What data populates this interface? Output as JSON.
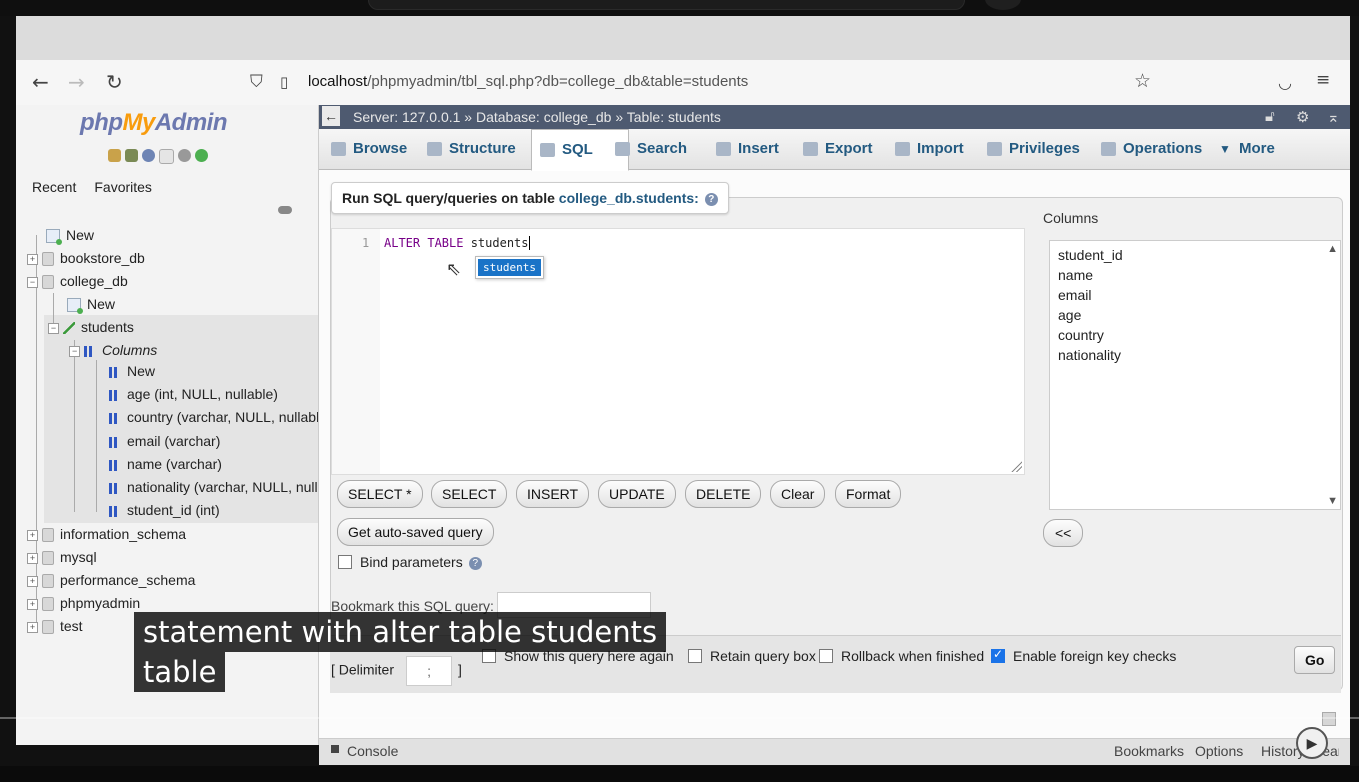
{
  "browser": {
    "url_host": "localhost",
    "url_path": "/phpmyadmin/tbl_sql.php?db=college_db&table=students"
  },
  "sidebar": {
    "logo_php": "php",
    "logo_my": "My",
    "logo_admin": "Admin",
    "tabs": [
      "Recent",
      "Favorites"
    ],
    "tree": {
      "new_root": "New",
      "bookstore": "bookstore_db",
      "college": "college_db",
      "college_new": "New",
      "students": "students",
      "columns": "Columns",
      "col_new": "New",
      "columns_list": [
        "age (int, NULL, nullable)",
        "country (varchar, NULL, nullable)",
        "email (varchar)",
        "name (varchar)",
        "nationality (varchar, NULL, nullable)",
        "student_id (int)"
      ],
      "info": "information_schema",
      "mysql": "mysql",
      "perf": "performance_schema",
      "pma": "phpmyadmin",
      "test": "test"
    }
  },
  "breadcrumb": {
    "server": "Server: 127.0.0.1",
    "database": "Database: college_db",
    "table": "Table: students",
    "sep": "»"
  },
  "tabs": [
    "Browse",
    "Structure",
    "SQL",
    "Search",
    "Insert",
    "Export",
    "Import",
    "Privileges",
    "Operations",
    "More"
  ],
  "sql": {
    "title_prefix": "Run SQL query/queries on table",
    "title_table": "college_db.students:",
    "line_number": "1",
    "code_kw": "ALTER TABLE",
    "code_rest": " students",
    "hint": "students",
    "buttons": [
      "SELECT *",
      "SELECT",
      "INSERT",
      "UPDATE",
      "DELETE",
      "Clear",
      "Format"
    ],
    "autosaved": "Get auto-saved query",
    "bind_params": "Bind parameters",
    "bookmark": "Bookmark this SQL query:",
    "delimiter_label": "[ Delimiter",
    "delimiter_value": ";",
    "delimiter_end": "]",
    "opt_show": "Show this query here again",
    "opt_retain": "Retain query box",
    "opt_rollback": "Rollback when finished",
    "opt_fk": "Enable foreign key checks",
    "go": "Go"
  },
  "columns_panel": {
    "label": "Columns",
    "items": [
      "student_id",
      "name",
      "email",
      "age",
      "country",
      "nationality"
    ],
    "insert_button": "<<"
  },
  "console": {
    "label": "Console",
    "links": [
      "Bookmarks",
      "Options",
      "History",
      "Clear"
    ]
  },
  "subtitles": [
    "statement with alter table students",
    "table"
  ]
}
